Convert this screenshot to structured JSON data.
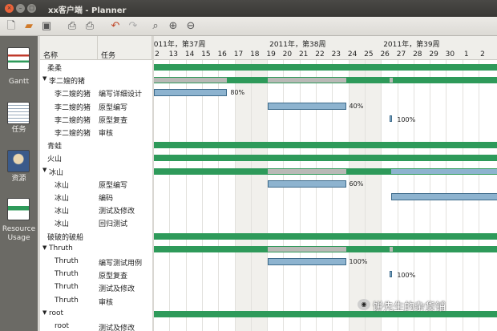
{
  "window": {
    "title": "xx客户端 - Planner"
  },
  "toolbar": {
    "icons": [
      "new-doc-icon",
      "open-folder-icon",
      "save-icon",
      "print-icon",
      "print-preview-icon",
      "undo-icon",
      "redo-icon",
      "zoom-fit-icon",
      "zoom-in-icon",
      "zoom-out-icon"
    ]
  },
  "sidebar": {
    "items": [
      {
        "label": "Gantt",
        "icon": "gantt-icon"
      },
      {
        "label": "任务",
        "icon": "task-icon"
      },
      {
        "label": "资源",
        "icon": "resource-icon"
      },
      {
        "label": "Resource Usage",
        "label_lines": [
          "Resource",
          "Usage"
        ],
        "icon": "resource-usage-icon"
      }
    ]
  },
  "table": {
    "headers": [
      "名称",
      "任务"
    ],
    "rows": [
      {
        "name": "柔柔",
        "task": "",
        "level": 0,
        "expander": ""
      },
      {
        "name": "李二嫂的猪",
        "task": "",
        "level": 0,
        "expander": "▼"
      },
      {
        "name": "李二嫂的猪",
        "task": "编写详细设计",
        "level": 1,
        "expander": ""
      },
      {
        "name": "李二嫂的猪",
        "task": "原型编写",
        "level": 1,
        "expander": ""
      },
      {
        "name": "李二嫂的猪",
        "task": "原型复查",
        "level": 1,
        "expander": ""
      },
      {
        "name": "李二嫂的猪",
        "task": "审核",
        "level": 1,
        "expander": ""
      },
      {
        "name": "青蛙",
        "task": "",
        "level": 0,
        "expander": ""
      },
      {
        "name": "火山",
        "task": "",
        "level": 0,
        "expander": ""
      },
      {
        "name": "冰山",
        "task": "",
        "level": 0,
        "expander": "▼"
      },
      {
        "name": "冰山",
        "task": "原型编写",
        "level": 1,
        "expander": ""
      },
      {
        "name": "冰山",
        "task": "编码",
        "level": 1,
        "expander": ""
      },
      {
        "name": "冰山",
        "task": "测试及修改",
        "level": 1,
        "expander": ""
      },
      {
        "name": "冰山",
        "task": "回归测试",
        "level": 1,
        "expander": ""
      },
      {
        "name": "破破的破船",
        "task": "",
        "level": 0,
        "expander": ""
      },
      {
        "name": "Thruth",
        "task": "",
        "level": 0,
        "expander": "▼"
      },
      {
        "name": "Thruth",
        "task": "编写测试用例",
        "level": 1,
        "expander": ""
      },
      {
        "name": "Thruth",
        "task": "原型复查",
        "level": 1,
        "expander": ""
      },
      {
        "name": "Thruth",
        "task": "测试及修改",
        "level": 1,
        "expander": ""
      },
      {
        "name": "Thruth",
        "task": "审核",
        "level": 1,
        "expander": ""
      },
      {
        "name": "root",
        "task": "",
        "level": 0,
        "expander": "▼"
      },
      {
        "name": "root",
        "task": "测试及修改",
        "level": 1,
        "expander": ""
      }
    ]
  },
  "gantt": {
    "weeks": [
      "2011年，第37周",
      "2011年，第38周",
      "2011年，第39周"
    ],
    "days": [
      "2",
      "13",
      "14",
      "15",
      "16",
      "17",
      "18",
      "19",
      "20",
      "21",
      "22",
      "23",
      "24",
      "25",
      "26",
      "27",
      "28",
      "29",
      "30",
      "1",
      "2"
    ],
    "weekend_days": [
      "17",
      "18",
      "24",
      "25"
    ],
    "bars": [
      {
        "row": 0,
        "kind": "summary",
        "start": 0,
        "end": 21
      },
      {
        "row": 1,
        "kind": "summary",
        "start": 0,
        "end": 21,
        "progress_segments": [
          [
            0,
            4.5
          ],
          [
            7,
            11.8
          ],
          [
            14.5,
            14.7
          ]
        ]
      },
      {
        "row": 2,
        "kind": "task",
        "start": 0,
        "end": 4.5,
        "label": "80%"
      },
      {
        "row": 3,
        "kind": "task",
        "start": 7,
        "end": 11.8,
        "label": "40%"
      },
      {
        "row": 4,
        "kind": "milestone",
        "start": 14.5,
        "label": "100%"
      },
      {
        "row": 6,
        "kind": "summary",
        "start": 0,
        "end": 21
      },
      {
        "row": 7,
        "kind": "summary",
        "start": 0,
        "end": 21
      },
      {
        "row": 8,
        "kind": "summary",
        "start": 0,
        "end": 21,
        "progress_segments": [
          [
            7,
            11.8
          ]
        ],
        "blue_segments": [
          [
            14.6,
            21
          ]
        ]
      },
      {
        "row": 9,
        "kind": "task",
        "start": 7,
        "end": 11.8,
        "label": "60%"
      },
      {
        "row": 10,
        "kind": "task",
        "start": 14.6,
        "end": 21.3,
        "label": ""
      },
      {
        "row": 13,
        "kind": "summary",
        "start": 0,
        "end": 21
      },
      {
        "row": 14,
        "kind": "summary",
        "start": 0,
        "end": 21,
        "progress_segments": [
          [
            7,
            11.8
          ],
          [
            14.5,
            14.7
          ]
        ]
      },
      {
        "row": 15,
        "kind": "task",
        "start": 7,
        "end": 11.8,
        "label": "100%"
      },
      {
        "row": 16,
        "kind": "milestone",
        "start": 14.5,
        "label": "100%"
      },
      {
        "row": 19,
        "kind": "summary",
        "start": 0,
        "end": 21
      }
    ]
  },
  "watermark": "饼先生的杂货铺",
  "colors": {
    "summary": "#2e9a5a",
    "task": "#8db3cf",
    "task_border": "#3c6a8a",
    "progress": "#b9b9b6",
    "sidebar": "#6b6a65"
  }
}
